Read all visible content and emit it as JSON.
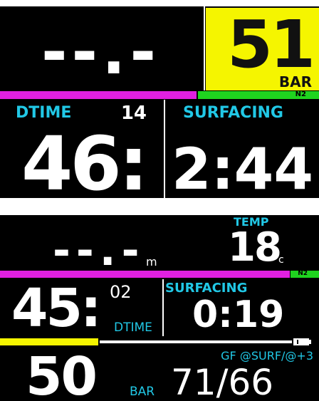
{
  "screen1": {
    "depth_value": "--.-",
    "tank_pressure_value": "51",
    "tank_pressure_unit": "BAR",
    "gas_label": "N2",
    "dtime_label": "DTIME",
    "dtime_small_value": "14",
    "dtime_value": "46:",
    "surfacing_label": "SURFACING",
    "surfacing_value": "2:44",
    "n2_bar_fraction": 0.62
  },
  "screen2": {
    "depth_value": "--.-",
    "depth_unit": "m",
    "temp_label": "TEMP",
    "temp_value": "18",
    "temp_unit": "°c",
    "gas_label": "N2",
    "dtime_value": "45:",
    "dtime_small_value": "02",
    "dtime_label": "DTIME",
    "surfacing_label": "SURFACING",
    "surfacing_value": "0:19",
    "pressure_value": "50",
    "pressure_unit": "BAR",
    "gf_label": "GF @SURF/@+3",
    "gf_value": "71/66",
    "n2_bar_fraction": 0.91,
    "yellow_bar_fraction": 0.31
  },
  "colors": {
    "accent_cyan": "#21c8e6",
    "tank_yellow": "#f5f500",
    "n2_magenta": "#e020e0",
    "n2_green": "#1fd41f",
    "background": "#000000"
  }
}
